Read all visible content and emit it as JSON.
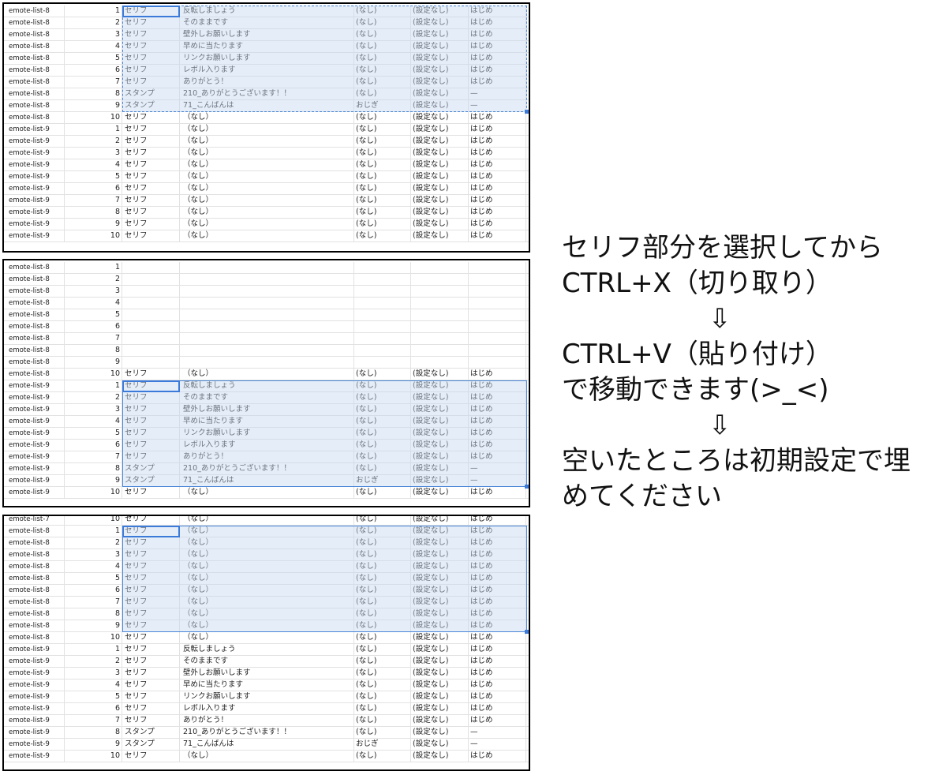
{
  "panels": [
    {
      "rows": [
        {
          "list": "emote-list-8",
          "num": "1",
          "type": "セリフ",
          "text": "反転しましょう",
          "action": "(なし)",
          "setting": "(設定なし)",
          "category": "はじめ"
        },
        {
          "list": "emote-list-8",
          "num": "2",
          "type": "セリフ",
          "text": "そのままです",
          "action": "(なし)",
          "setting": "(設定なし)",
          "category": "はじめ"
        },
        {
          "list": "emote-list-8",
          "num": "3",
          "type": "セリフ",
          "text": "壁外しお願いします",
          "action": "(なし)",
          "setting": "(設定なし)",
          "category": "はじめ"
        },
        {
          "list": "emote-list-8",
          "num": "4",
          "type": "セリフ",
          "text": "早めに当たります",
          "action": "(なし)",
          "setting": "(設定なし)",
          "category": "はじめ"
        },
        {
          "list": "emote-list-8",
          "num": "5",
          "type": "セリフ",
          "text": "リンクお願いします",
          "action": "(なし)",
          "setting": "(設定なし)",
          "category": "はじめ"
        },
        {
          "list": "emote-list-8",
          "num": "6",
          "type": "セリフ",
          "text": "レボル入ります",
          "action": "(なし)",
          "setting": "(設定なし)",
          "category": "はじめ"
        },
        {
          "list": "emote-list-8",
          "num": "7",
          "type": "セリフ",
          "text": "ありがとう！",
          "action": "(なし)",
          "setting": "(設定なし)",
          "category": "はじめ"
        },
        {
          "list": "emote-list-8",
          "num": "8",
          "type": "スタンプ",
          "text": "210_ありがとうございます！！",
          "action": "(なし)",
          "setting": "(設定なし)",
          "category": "—"
        },
        {
          "list": "emote-list-8",
          "num": "9",
          "type": "スタンプ",
          "text": "71_こんばんは",
          "action": "おじぎ",
          "setting": "(設定なし)",
          "category": "—"
        },
        {
          "list": "emote-list-8",
          "num": "10",
          "type": "セリフ",
          "text": "（なし）",
          "action": "(なし)",
          "setting": "(設定なし)",
          "category": "はじめ"
        },
        {
          "list": "emote-list-9",
          "num": "1",
          "type": "セリフ",
          "text": "（なし）",
          "action": "(なし)",
          "setting": "(設定なし)",
          "category": "はじめ"
        },
        {
          "list": "emote-list-9",
          "num": "2",
          "type": "セリフ",
          "text": "（なし）",
          "action": "(なし)",
          "setting": "(設定なし)",
          "category": "はじめ"
        },
        {
          "list": "emote-list-9",
          "num": "3",
          "type": "セリフ",
          "text": "（なし）",
          "action": "(なし)",
          "setting": "(設定なし)",
          "category": "はじめ"
        },
        {
          "list": "emote-list-9",
          "num": "4",
          "type": "セリフ",
          "text": "（なし）",
          "action": "(なし)",
          "setting": "(設定なし)",
          "category": "はじめ"
        },
        {
          "list": "emote-list-9",
          "num": "5",
          "type": "セリフ",
          "text": "（なし）",
          "action": "(なし)",
          "setting": "(設定なし)",
          "category": "はじめ"
        },
        {
          "list": "emote-list-9",
          "num": "6",
          "type": "セリフ",
          "text": "（なし）",
          "action": "(なし)",
          "setting": "(設定なし)",
          "category": "はじめ"
        },
        {
          "list": "emote-list-9",
          "num": "7",
          "type": "セリフ",
          "text": "（なし）",
          "action": "(なし)",
          "setting": "(設定なし)",
          "category": "はじめ"
        },
        {
          "list": "emote-list-9",
          "num": "8",
          "type": "セリフ",
          "text": "（なし）",
          "action": "(なし)",
          "setting": "(設定なし)",
          "category": "はじめ"
        },
        {
          "list": "emote-list-9",
          "num": "9",
          "type": "セリフ",
          "text": "（なし）",
          "action": "(なし)",
          "setting": "(設定なし)",
          "category": "はじめ"
        },
        {
          "list": "emote-list-9",
          "num": "10",
          "type": "セリフ",
          "text": "（なし）",
          "action": "(なし)",
          "setting": "(設定なし)",
          "category": "はじめ"
        }
      ]
    },
    {
      "rows": [
        {
          "list": "emote-list-8",
          "num": "1",
          "type": "",
          "text": "",
          "action": "",
          "setting": "",
          "category": ""
        },
        {
          "list": "emote-list-8",
          "num": "2",
          "type": "",
          "text": "",
          "action": "",
          "setting": "",
          "category": ""
        },
        {
          "list": "emote-list-8",
          "num": "3",
          "type": "",
          "text": "",
          "action": "",
          "setting": "",
          "category": ""
        },
        {
          "list": "emote-list-8",
          "num": "4",
          "type": "",
          "text": "",
          "action": "",
          "setting": "",
          "category": ""
        },
        {
          "list": "emote-list-8",
          "num": "5",
          "type": "",
          "text": "",
          "action": "",
          "setting": "",
          "category": ""
        },
        {
          "list": "emote-list-8",
          "num": "6",
          "type": "",
          "text": "",
          "action": "",
          "setting": "",
          "category": ""
        },
        {
          "list": "emote-list-8",
          "num": "7",
          "type": "",
          "text": "",
          "action": "",
          "setting": "",
          "category": ""
        },
        {
          "list": "emote-list-8",
          "num": "8",
          "type": "",
          "text": "",
          "action": "",
          "setting": "",
          "category": ""
        },
        {
          "list": "emote-list-8",
          "num": "9",
          "type": "",
          "text": "",
          "action": "",
          "setting": "",
          "category": ""
        },
        {
          "list": "emote-list-8",
          "num": "10",
          "type": "セリフ",
          "text": "（なし）",
          "action": "(なし)",
          "setting": "(設定なし)",
          "category": "はじめ"
        },
        {
          "list": "emote-list-9",
          "num": "1",
          "type": "セリフ",
          "text": "反転しましょう",
          "action": "(なし)",
          "setting": "(設定なし)",
          "category": "はじめ"
        },
        {
          "list": "emote-list-9",
          "num": "2",
          "type": "セリフ",
          "text": "そのままです",
          "action": "(なし)",
          "setting": "(設定なし)",
          "category": "はじめ"
        },
        {
          "list": "emote-list-9",
          "num": "3",
          "type": "セリフ",
          "text": "壁外しお願いします",
          "action": "(なし)",
          "setting": "(設定なし)",
          "category": "はじめ"
        },
        {
          "list": "emote-list-9",
          "num": "4",
          "type": "セリフ",
          "text": "早めに当たります",
          "action": "(なし)",
          "setting": "(設定なし)",
          "category": "はじめ"
        },
        {
          "list": "emote-list-9",
          "num": "5",
          "type": "セリフ",
          "text": "リンクお願いします",
          "action": "(なし)",
          "setting": "(設定なし)",
          "category": "はじめ"
        },
        {
          "list": "emote-list-9",
          "num": "6",
          "type": "セリフ",
          "text": "レボル入ります",
          "action": "(なし)",
          "setting": "(設定なし)",
          "category": "はじめ"
        },
        {
          "list": "emote-list-9",
          "num": "7",
          "type": "セリフ",
          "text": "ありがとう！",
          "action": "(なし)",
          "setting": "(設定なし)",
          "category": "はじめ"
        },
        {
          "list": "emote-list-9",
          "num": "8",
          "type": "スタンプ",
          "text": "210_ありがとうございます！！",
          "action": "(なし)",
          "setting": "(設定なし)",
          "category": "—"
        },
        {
          "list": "emote-list-9",
          "num": "9",
          "type": "スタンプ",
          "text": "71_こんばんは",
          "action": "おじぎ",
          "setting": "(設定なし)",
          "category": "—"
        },
        {
          "list": "emote-list-9",
          "num": "10",
          "type": "セリフ",
          "text": "（なし）",
          "action": "(なし)",
          "setting": "(設定なし)",
          "category": "はじめ"
        }
      ]
    },
    {
      "rows": [
        {
          "list": "emote-list-7",
          "num": "10",
          "type": "セリフ",
          "text": "（なし）",
          "action": "(なし)",
          "setting": "(設定なし)",
          "category": "はじめ"
        },
        {
          "list": "emote-list-8",
          "num": "1",
          "type": "セリフ",
          "text": "（なし）",
          "action": "(なし)",
          "setting": "(設定なし)",
          "category": "はじめ"
        },
        {
          "list": "emote-list-8",
          "num": "2",
          "type": "セリフ",
          "text": "（なし）",
          "action": "(なし)",
          "setting": "(設定なし)",
          "category": "はじめ"
        },
        {
          "list": "emote-list-8",
          "num": "3",
          "type": "セリフ",
          "text": "（なし）",
          "action": "(なし)",
          "setting": "(設定なし)",
          "category": "はじめ"
        },
        {
          "list": "emote-list-8",
          "num": "4",
          "type": "セリフ",
          "text": "（なし）",
          "action": "(なし)",
          "setting": "(設定なし)",
          "category": "はじめ"
        },
        {
          "list": "emote-list-8",
          "num": "5",
          "type": "セリフ",
          "text": "（なし）",
          "action": "(なし)",
          "setting": "(設定なし)",
          "category": "はじめ"
        },
        {
          "list": "emote-list-8",
          "num": "6",
          "type": "セリフ",
          "text": "（なし）",
          "action": "(なし)",
          "setting": "(設定なし)",
          "category": "はじめ"
        },
        {
          "list": "emote-list-8",
          "num": "7",
          "type": "セリフ",
          "text": "（なし）",
          "action": "(なし)",
          "setting": "(設定なし)",
          "category": "はじめ"
        },
        {
          "list": "emote-list-8",
          "num": "8",
          "type": "セリフ",
          "text": "（なし）",
          "action": "(なし)",
          "setting": "(設定なし)",
          "category": "はじめ"
        },
        {
          "list": "emote-list-8",
          "num": "9",
          "type": "セリフ",
          "text": "（なし）",
          "action": "(なし)",
          "setting": "(設定なし)",
          "category": "はじめ"
        },
        {
          "list": "emote-list-8",
          "num": "10",
          "type": "セリフ",
          "text": "（なし）",
          "action": "(なし)",
          "setting": "(設定なし)",
          "category": "はじめ"
        },
        {
          "list": "emote-list-9",
          "num": "1",
          "type": "セリフ",
          "text": "反転しましょう",
          "action": "(なし)",
          "setting": "(設定なし)",
          "category": "はじめ"
        },
        {
          "list": "emote-list-9",
          "num": "2",
          "type": "セリフ",
          "text": "そのままです",
          "action": "(なし)",
          "setting": "(設定なし)",
          "category": "はじめ"
        },
        {
          "list": "emote-list-9",
          "num": "3",
          "type": "セリフ",
          "text": "壁外しお願いします",
          "action": "(なし)",
          "setting": "(設定なし)",
          "category": "はじめ"
        },
        {
          "list": "emote-list-9",
          "num": "4",
          "type": "セリフ",
          "text": "早めに当たります",
          "action": "(なし)",
          "setting": "(設定なし)",
          "category": "はじめ"
        },
        {
          "list": "emote-list-9",
          "num": "5",
          "type": "セリフ",
          "text": "リンクお願いします",
          "action": "(なし)",
          "setting": "(設定なし)",
          "category": "はじめ"
        },
        {
          "list": "emote-list-9",
          "num": "6",
          "type": "セリフ",
          "text": "レボル入ります",
          "action": "(なし)",
          "setting": "(設定なし)",
          "category": "はじめ"
        },
        {
          "list": "emote-list-9",
          "num": "7",
          "type": "セリフ",
          "text": "ありがとう！",
          "action": "(なし)",
          "setting": "(設定なし)",
          "category": "はじめ"
        },
        {
          "list": "emote-list-9",
          "num": "8",
          "type": "スタンプ",
          "text": "210_ありがとうございます！！",
          "action": "(なし)",
          "setting": "(設定なし)",
          "category": "—"
        },
        {
          "list": "emote-list-9",
          "num": "9",
          "type": "スタンプ",
          "text": "71_こんばんは",
          "action": "おじぎ",
          "setting": "(設定なし)",
          "category": "—"
        },
        {
          "list": "emote-list-9",
          "num": "10",
          "type": "セリフ",
          "text": "（なし）",
          "action": "(なし)",
          "setting": "(設定なし)",
          "category": "はじめ"
        }
      ]
    }
  ],
  "instructions": {
    "line1": "セリフ部分を選択してから",
    "line2": "CTRL+X（切り取り）",
    "arrow1": "⇩",
    "line3": "CTRL+V（貼り付け）",
    "line4": "で移動できます(>_<)",
    "arrow2": "⇩",
    "line5": "空いたところは初期設定で埋",
    "line6": "めてください"
  },
  "colors": {
    "selection_fill": "#c4d8f0",
    "selection_border": "#4a86d6",
    "panel_border": "#000000",
    "grid_line": "#e2e2e2"
  }
}
